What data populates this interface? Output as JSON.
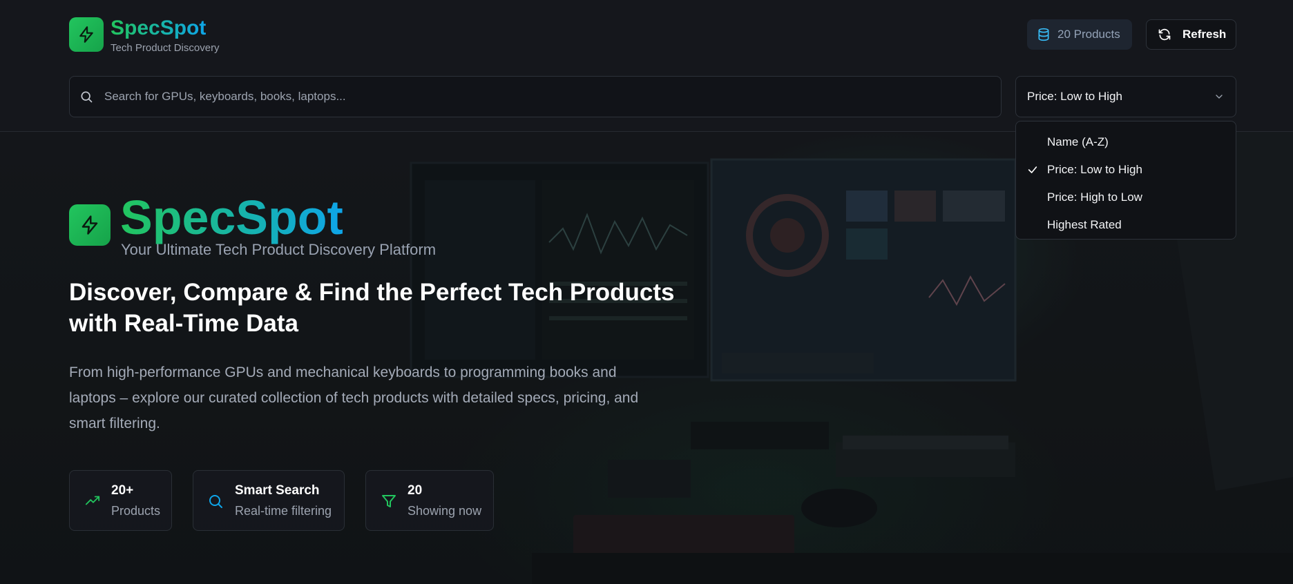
{
  "colors": {
    "accent_green": "#22c55e",
    "accent_blue": "#0ea5e9",
    "background": "#14161b"
  },
  "header": {
    "brand_name": "SpecSpot",
    "brand_tagline": "Tech Product Discovery",
    "logo_icon": "lightning-bolt-icon",
    "product_count_label": "20 Products",
    "product_count_icon": "database-icon",
    "refresh_label": "Refresh",
    "refresh_icon": "refresh-icon"
  },
  "search": {
    "placeholder": "Search for GPUs, keyboards, books, laptops...",
    "value": "",
    "icon": "search-icon"
  },
  "sort": {
    "selected": "Price: Low to High",
    "options": [
      {
        "label": "Name (A-Z)",
        "checked": false
      },
      {
        "label": "Price: Low to High",
        "checked": true
      },
      {
        "label": "Price: High to Low",
        "checked": false
      },
      {
        "label": "Highest Rated",
        "checked": false
      }
    ]
  },
  "hero": {
    "brand_name": "SpecSpot",
    "tagline": "Your Ultimate Tech Product Discovery Platform",
    "title": "Discover, Compare & Find the Perfect Tech Products with Real-Time Data",
    "description": "From high-performance GPUs and mechanical keyboards to programming books and laptops – explore our curated collection of tech products with detailed specs, pricing, and smart filtering.",
    "stats": [
      {
        "icon": "trending-up-icon",
        "value": "20+",
        "label": "Products"
      },
      {
        "icon": "search-icon",
        "value": "Smart Search",
        "label": "Real-time filtering"
      },
      {
        "icon": "filter-icon",
        "value": "20",
        "label": "Showing now"
      }
    ]
  }
}
